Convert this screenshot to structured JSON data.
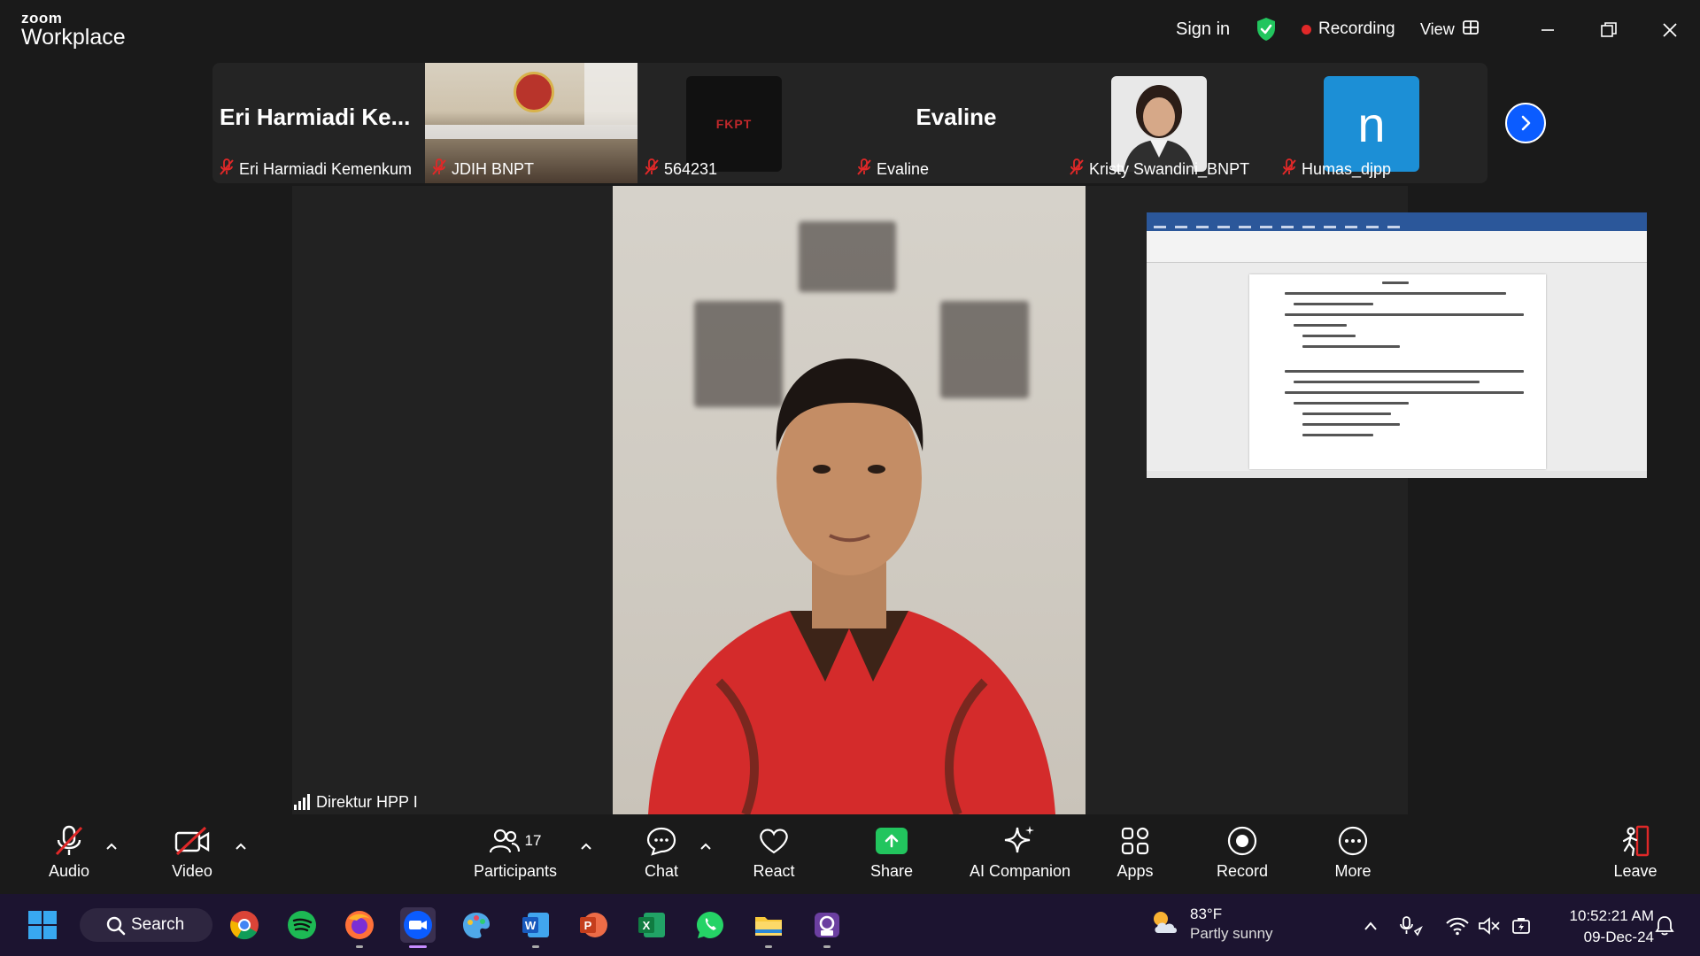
{
  "app": {
    "brand_line1": "zoom",
    "brand_line2": "Workplace"
  },
  "titlebar": {
    "sign_in": "Sign in",
    "recording_label": "Recording",
    "view_label": "View"
  },
  "participants_strip": {
    "tiles": [
      {
        "big_name": "Eri Harmiadi Ke...",
        "name": "Eri Harmiadi Kemenkum"
      },
      {
        "name": "JDIH BNPT"
      },
      {
        "name": "564231",
        "thumb_text": "FKPT"
      },
      {
        "big_name": "Evaline",
        "name": "Evaline"
      },
      {
        "name": "Kristy Swandini_BNPT"
      },
      {
        "name": "Humas_djpp",
        "avatar_letter": "n"
      }
    ]
  },
  "active_speaker": {
    "name": "Direktur HPP I"
  },
  "toolbar": {
    "audio": "Audio",
    "video": "Video",
    "participants": "Participants",
    "participant_count": "17",
    "chat": "Chat",
    "react": "React",
    "share": "Share",
    "ai_companion": "AI Companion",
    "apps": "Apps",
    "record": "Record",
    "more": "More",
    "leave": "Leave"
  },
  "taskbar": {
    "search": "Search",
    "weather_temp": "83°F",
    "weather_desc": "Partly sunny",
    "time": "10:52:21 AM",
    "date": "09-Dec-24"
  },
  "colors": {
    "accent_blue": "#0b5cff",
    "share_green": "#22c55e",
    "recording_red": "#e02828",
    "taskbar_bg": "#1c1430"
  }
}
